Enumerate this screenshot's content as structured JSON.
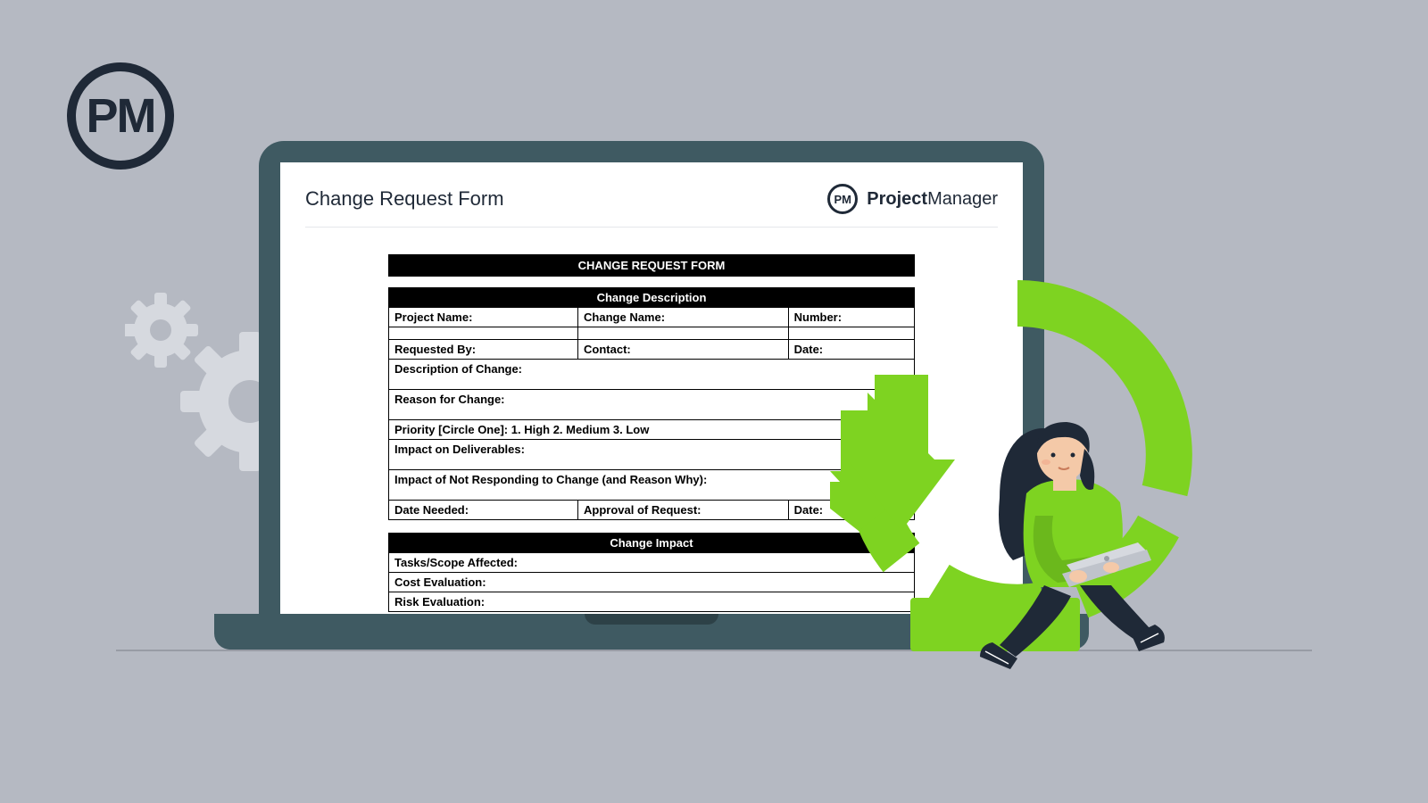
{
  "logo_text": "PM",
  "document": {
    "title": "Change Request Form",
    "brand_short": "PM",
    "brand_bold": "Project",
    "brand_rest": "Manager"
  },
  "form": {
    "main_title": "CHANGE REQUEST FORM",
    "section1": {
      "header": "Change Description",
      "project_name": "Project Name:",
      "change_name": "Change Name:",
      "number": "Number:",
      "requested_by": "Requested By:",
      "contact": "Contact:",
      "date": "Date:",
      "description": "Description of Change:",
      "reason": "Reason for Change:",
      "priority": "Priority [Circle One]:   1. High    2. Medium   3. Low",
      "impact_deliverables": "Impact on Deliverables:",
      "impact_not_responding": "Impact of Not Responding to Change (and Reason Why):",
      "date_needed": "Date Needed:",
      "approval": "Approval of Request:",
      "date2": "Date:"
    },
    "section2": {
      "header": "Change Impact",
      "tasks_scope": "Tasks/Scope Affected:",
      "cost_eval": "Cost Evaluation:",
      "risk_eval": "Risk Evaluation:"
    }
  }
}
